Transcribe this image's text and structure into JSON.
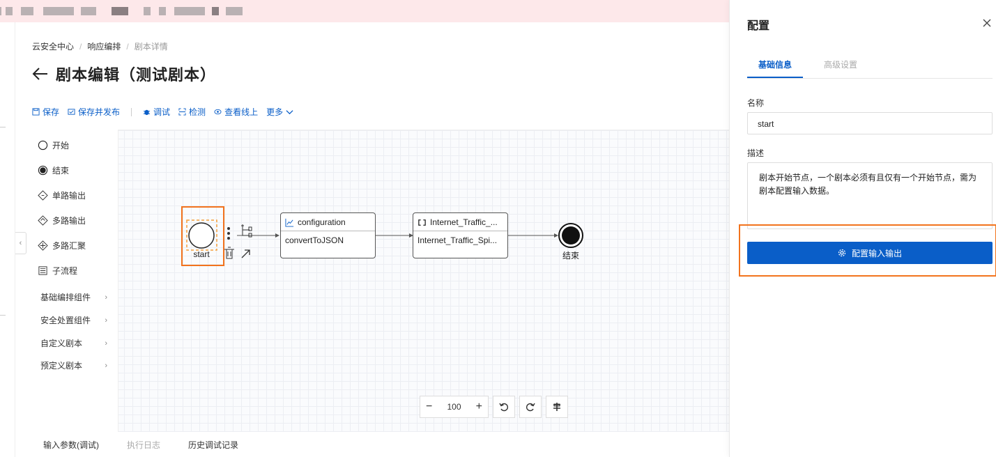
{
  "breadcrumb": {
    "items": [
      "云安全中心",
      "响应编排",
      "剧本详情"
    ]
  },
  "page": {
    "title": "剧本编辑（测试剧本）"
  },
  "toolbar": {
    "save": "保存",
    "save_publish": "保存并发布",
    "debug": "调试",
    "check": "检测",
    "view_online": "查看线上",
    "more": "更多"
  },
  "palette": {
    "items": [
      "开始",
      "结束",
      "单路输出",
      "多路输出",
      "多路汇聚",
      "子流程"
    ],
    "groups": [
      "基础编排组件",
      "安全处置组件",
      "自定义剧本",
      "预定义剧本"
    ]
  },
  "flow": {
    "start_label": "start",
    "node1": {
      "title": "configuration",
      "body": "convertToJSON"
    },
    "node2": {
      "title": "Internet_Traffic_...",
      "body": "Internet_Traffic_Spi..."
    },
    "end_label": "结束"
  },
  "zoom": {
    "value": "100"
  },
  "bottom_tabs": {
    "input_params": "输入参数(调试)",
    "exec_log": "执行日志",
    "history": "历史调试记录"
  },
  "panel": {
    "title": "配置",
    "tabs": {
      "basic": "基础信息",
      "advanced": "高级设置"
    },
    "name_label": "名称",
    "name_value": "start",
    "desc_label": "描述",
    "desc_value": "剧本开始节点，一个剧本必须有且仅有一个开始节点，需为剧本配置输入数据。",
    "config_button": "配置输入输出"
  },
  "colors": {
    "accent": "#0a5ec8",
    "highlight": "#f2731d"
  }
}
